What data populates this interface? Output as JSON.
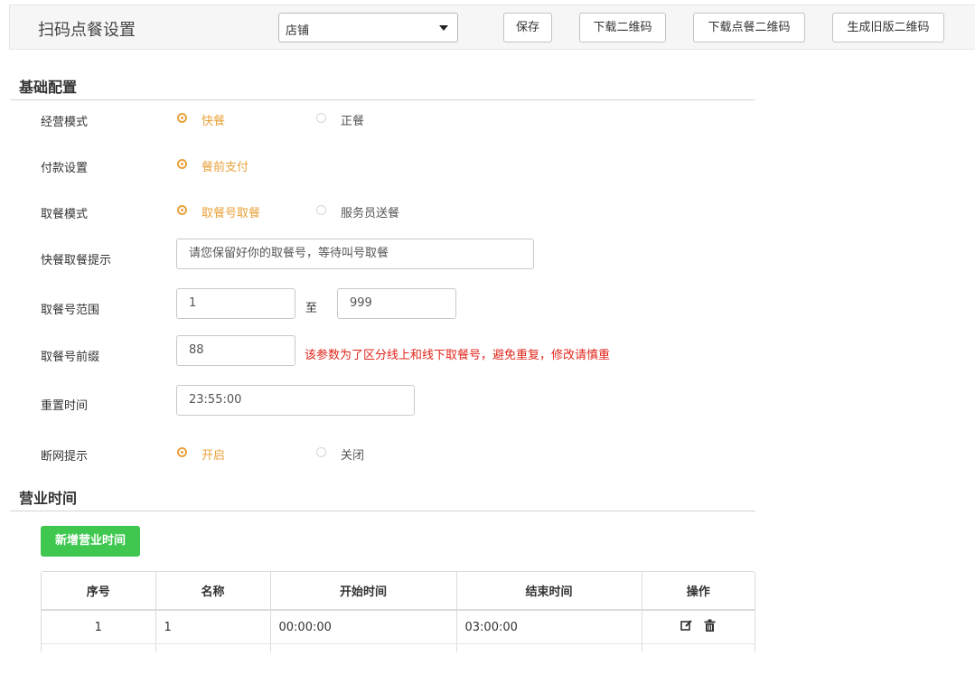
{
  "header": {
    "title": "扫码点餐设置",
    "store_select": "店铺",
    "buttons": {
      "save": "保存",
      "download_qr": "下载二维码",
      "download_order_qr": "下载点餐二维码",
      "gen_old_qr": "生成旧版二维码"
    }
  },
  "basic": {
    "title": "基础配置",
    "mode": {
      "label": "经营模式",
      "options": [
        "快餐",
        "正餐"
      ],
      "selected": "快餐"
    },
    "payment": {
      "label": "付款设置",
      "options": [
        "餐前支付"
      ],
      "selected": "餐前支付"
    },
    "pickup": {
      "label": "取餐模式",
      "options": [
        "取餐号取餐",
        "服务员送餐"
      ],
      "selected": "取餐号取餐"
    },
    "tip": {
      "label": "快餐取餐提示",
      "value": "请您保留好你的取餐号，等待叫号取餐"
    },
    "range": {
      "label": "取餐号范围",
      "from": "1",
      "to_label": "至",
      "to": "999"
    },
    "prefix": {
      "label": "取餐号前缀",
      "value": "88",
      "hint": "该参数为了区分线上和线下取餐号，避免重复，修改请慎重"
    },
    "reset": {
      "label": "重置时间",
      "value": "23:55:00"
    },
    "offline": {
      "label": "断网提示",
      "options": [
        "开启",
        "关闭"
      ],
      "selected": "开启"
    }
  },
  "hours": {
    "title": "营业时间",
    "add_button": "新增营业时间",
    "columns": [
      "序号",
      "名称",
      "开始时间",
      "结束时间",
      "操作"
    ],
    "rows": [
      {
        "no": "1",
        "name": "1",
        "start": "00:00:00",
        "end": "03:00:00"
      }
    ],
    "icons": {
      "edit": "edit-icon",
      "delete": "trash-icon"
    }
  },
  "colors": {
    "accent": "#e8a23a",
    "warning": "#e0251b",
    "primary_button": "#3fc74f"
  }
}
